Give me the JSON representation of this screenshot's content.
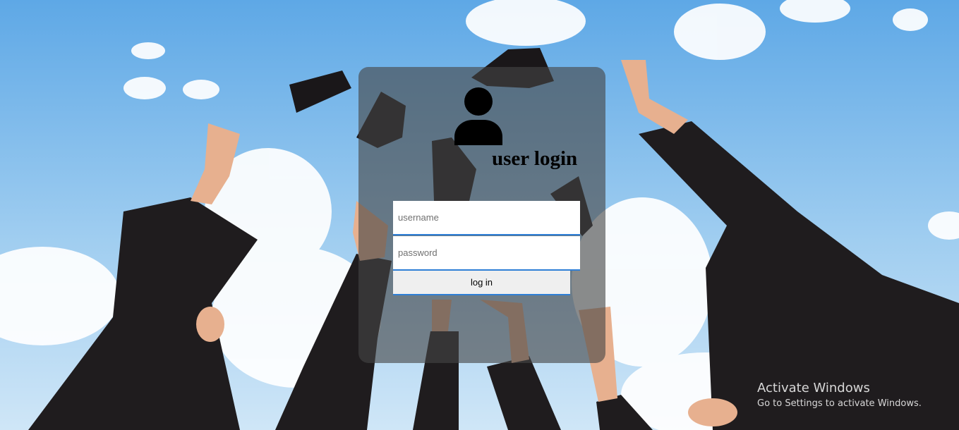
{
  "login": {
    "title": "user login",
    "username_placeholder": "username",
    "password_placeholder": "password",
    "submit_label": "log in",
    "icon": "user-icon"
  },
  "watermark": {
    "title": "Activate Windows",
    "subtitle": "Go to Settings to activate Windows."
  },
  "colors": {
    "sky": "#8ec3ec",
    "card": "#464646",
    "input_underline": "#2f7fd6",
    "button": "#efefef"
  }
}
